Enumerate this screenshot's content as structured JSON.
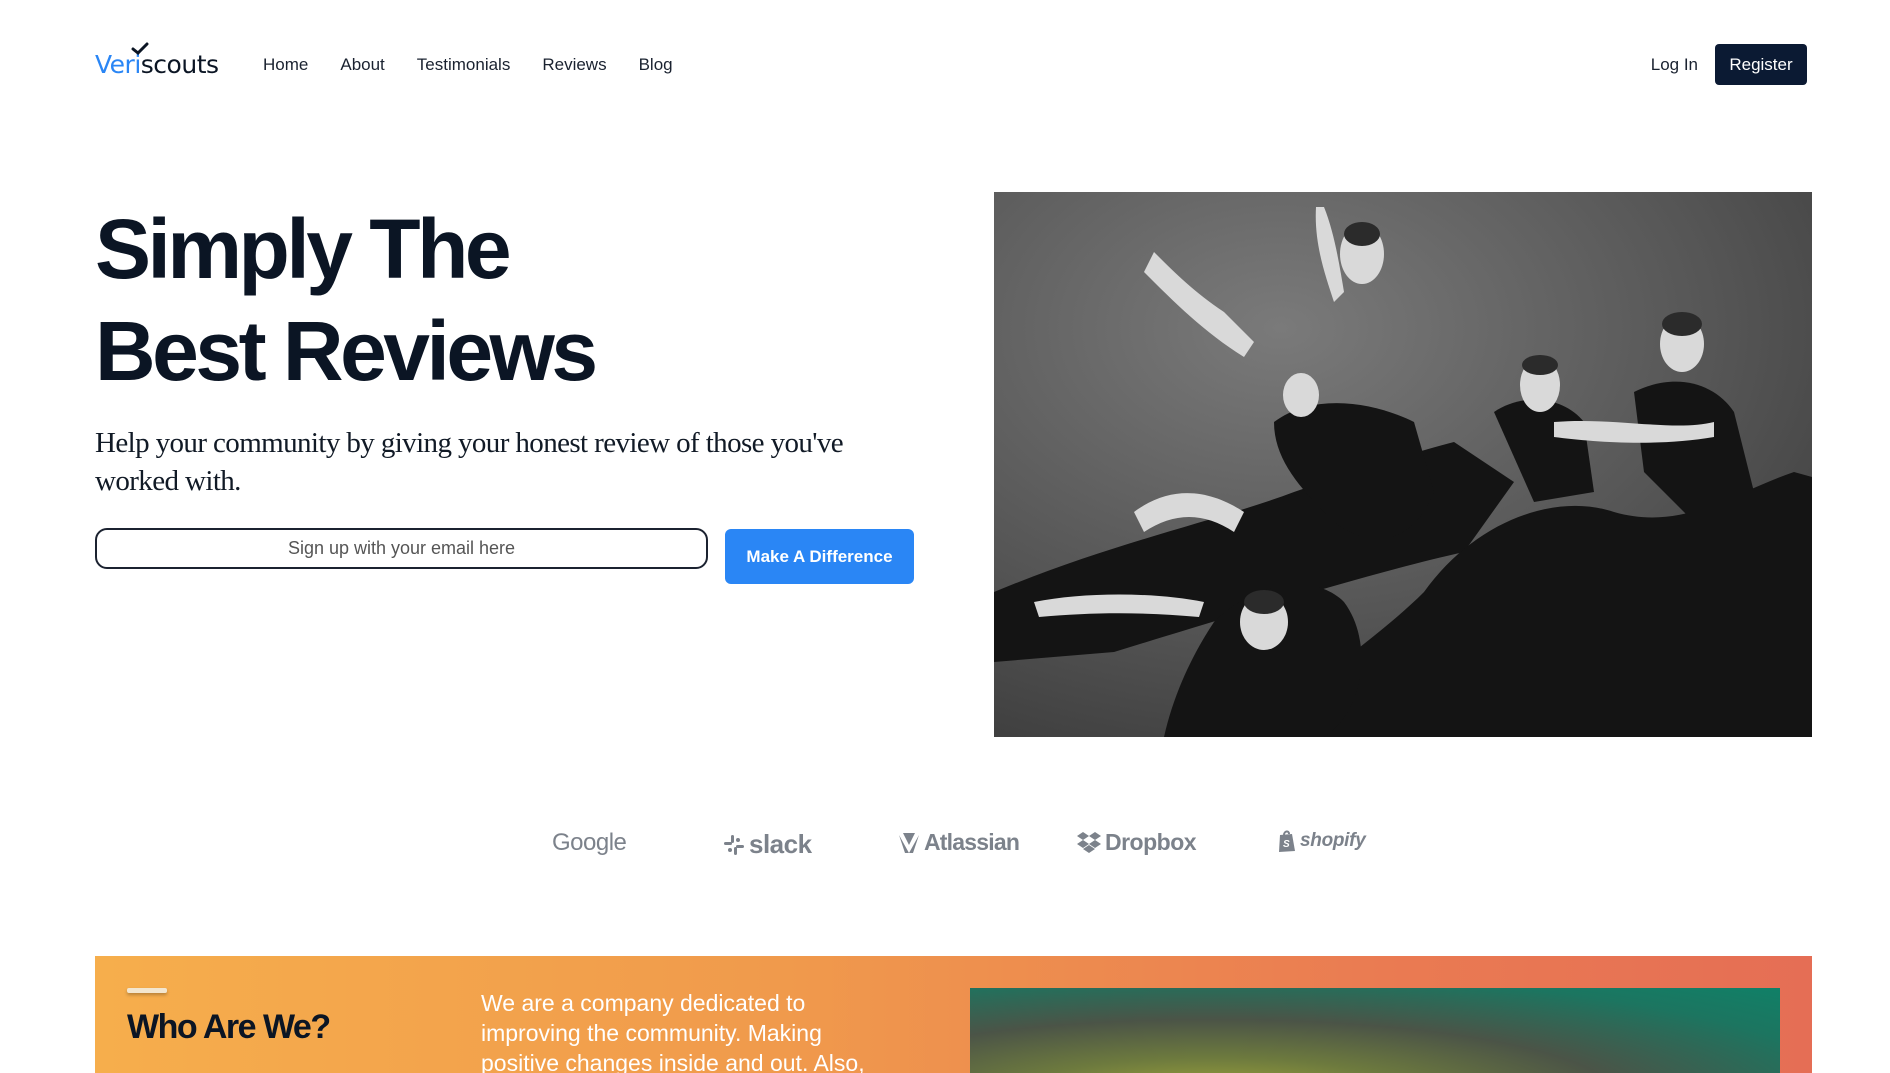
{
  "brand": {
    "logo_prefix": "Veri",
    "logo_suffix": "scouts"
  },
  "nav": {
    "links": [
      "Home",
      "About",
      "Testimonials",
      "Reviews",
      "Blog"
    ],
    "login_label": "Log In",
    "register_label": "Register"
  },
  "hero": {
    "title_line1": "Simply The",
    "title_line2": "Best Reviews",
    "subtitle": "Help your community by giving your honest review of those you've worked with.",
    "email_placeholder": "Sign up with your email here",
    "cta_label": "Make A Difference"
  },
  "partners": {
    "google": "Google",
    "slack": "slack",
    "atlassian": "Atlassian",
    "dropbox": "Dropbox",
    "shopify": "shopify"
  },
  "about": {
    "title": "Who Are We?",
    "text": "We are a company dedicated to improving the community. Making positive changes inside and out. Also,"
  },
  "colors": {
    "accent": "#2a86f5",
    "navy": "#0b1a33",
    "orange_start": "#f6ae4c",
    "orange_end": "#e56e55"
  }
}
